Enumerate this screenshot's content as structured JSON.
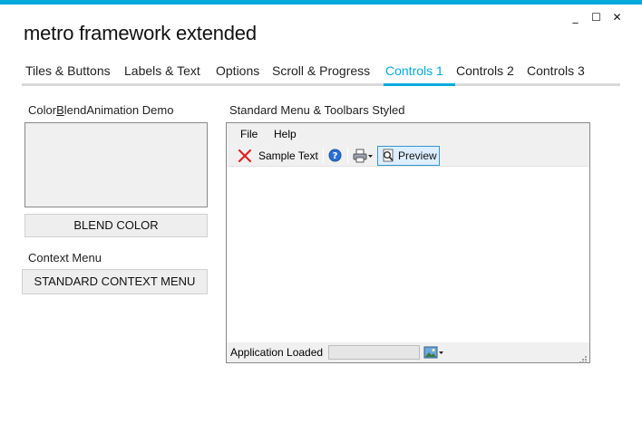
{
  "window": {
    "title": "metro framework extended",
    "controls": [
      "_",
      "☐",
      "✕"
    ],
    "accent_color": "#00aadd"
  },
  "tabs": [
    {
      "label": "Tiles & Buttons",
      "active": false
    },
    {
      "label": "Labels & Text",
      "active": false
    },
    {
      "label": "Options",
      "active": false
    },
    {
      "label": "Scroll & Progress",
      "active": false
    },
    {
      "label": "Controls 1",
      "active": true
    },
    {
      "label": "Controls 2",
      "active": false
    },
    {
      "label": "Controls 3",
      "active": false
    }
  ],
  "left": {
    "blend_title_pre": "Color",
    "blend_title_mnemonic": "B",
    "blend_title_post": "lendAnimation Demo",
    "blend_button": "BLEND COLOR",
    "context_title": "Context Menu",
    "context_button": "STANDARD CONTEXT MENU"
  },
  "right": {
    "title": "Standard Menu & Toolbars Styled",
    "menu": [
      "File",
      "Help"
    ],
    "toolbar": {
      "sample_text": "Sample Text",
      "preview": "Preview",
      "icons": [
        "close-x-icon",
        "help-icon",
        "print-icon",
        "print-preview-icon"
      ]
    },
    "status": {
      "text": "Application Loaded",
      "split_icon": "image-icon"
    }
  }
}
